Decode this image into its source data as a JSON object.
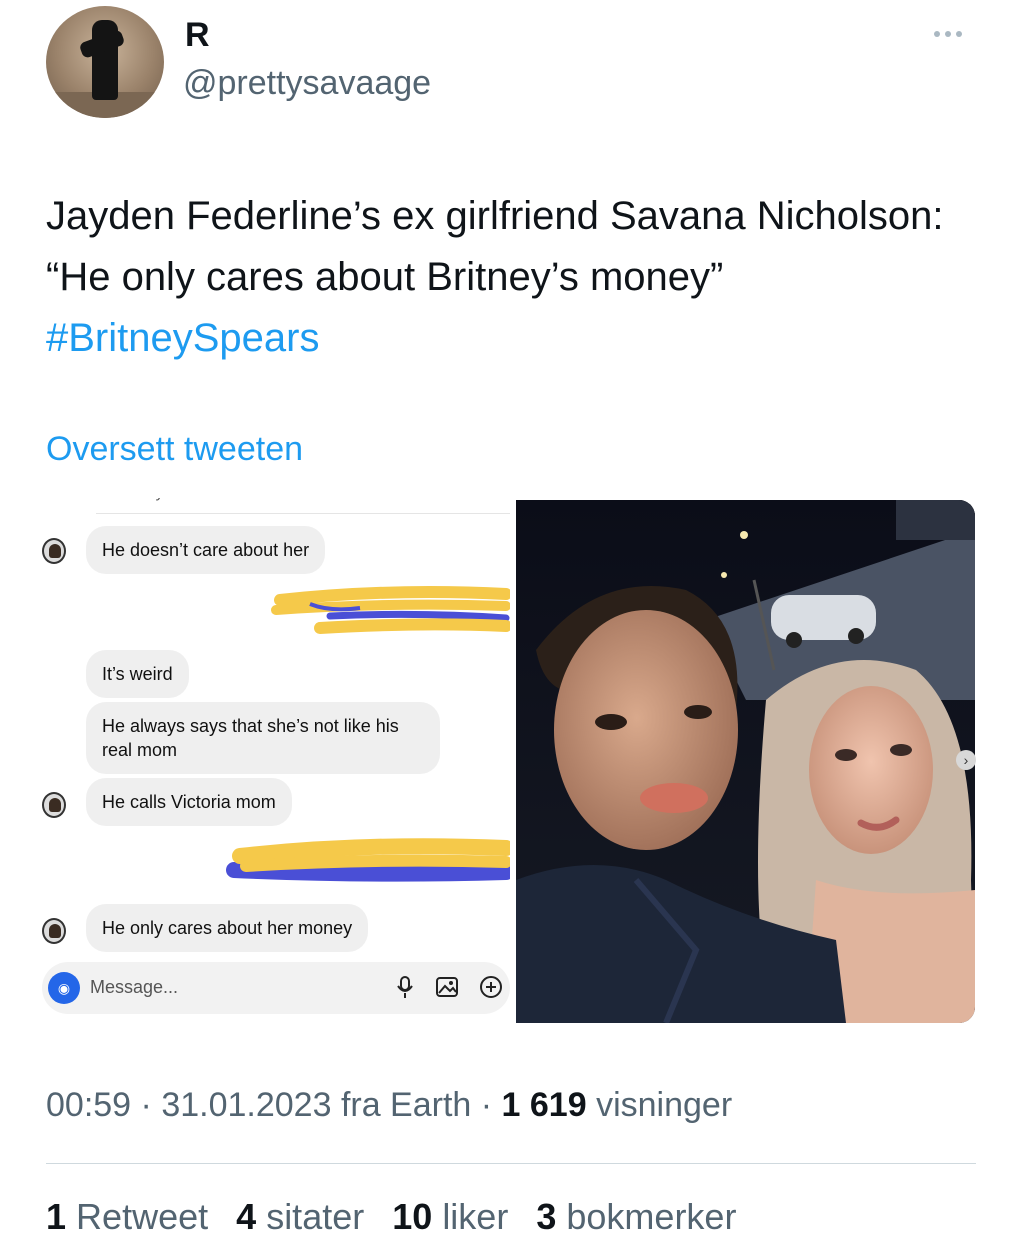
{
  "author": {
    "display_name": "R",
    "handle": "@prettysavaage"
  },
  "tweet": {
    "text_1": "Jayden Federline’s ex girlfriend Savana Nicholson: “He only cares about Britney’s money”",
    "hashtag": "#BritneySpears",
    "translate_label": "Oversett tweeten"
  },
  "chat": {
    "cut_top_text": "Not really",
    "messages": [
      "He doesn’t care about her",
      "It’s weird",
      "He always says that she’s not like his real mom",
      "He calls Victoria mom",
      "He only cares about her money"
    ],
    "message_placeholder": "Message..."
  },
  "meta": {
    "time": "00:59",
    "date": "31.01.2023",
    "source": "fra Earth",
    "views_count": "1 619",
    "views_label": "visninger"
  },
  "stats": {
    "retweets_count": "1",
    "retweets_label": "Retweet",
    "quotes_count": "4",
    "quotes_label": "sitater",
    "likes_count": "10",
    "likes_label": "liker",
    "bookmarks_count": "3",
    "bookmarks_label": "bokmerker"
  },
  "colors": {
    "link": "#1d9bf0",
    "secondary_text": "#536471",
    "scribble_yellow": "#f5c94a",
    "scribble_blue": "#4a4fd6"
  }
}
